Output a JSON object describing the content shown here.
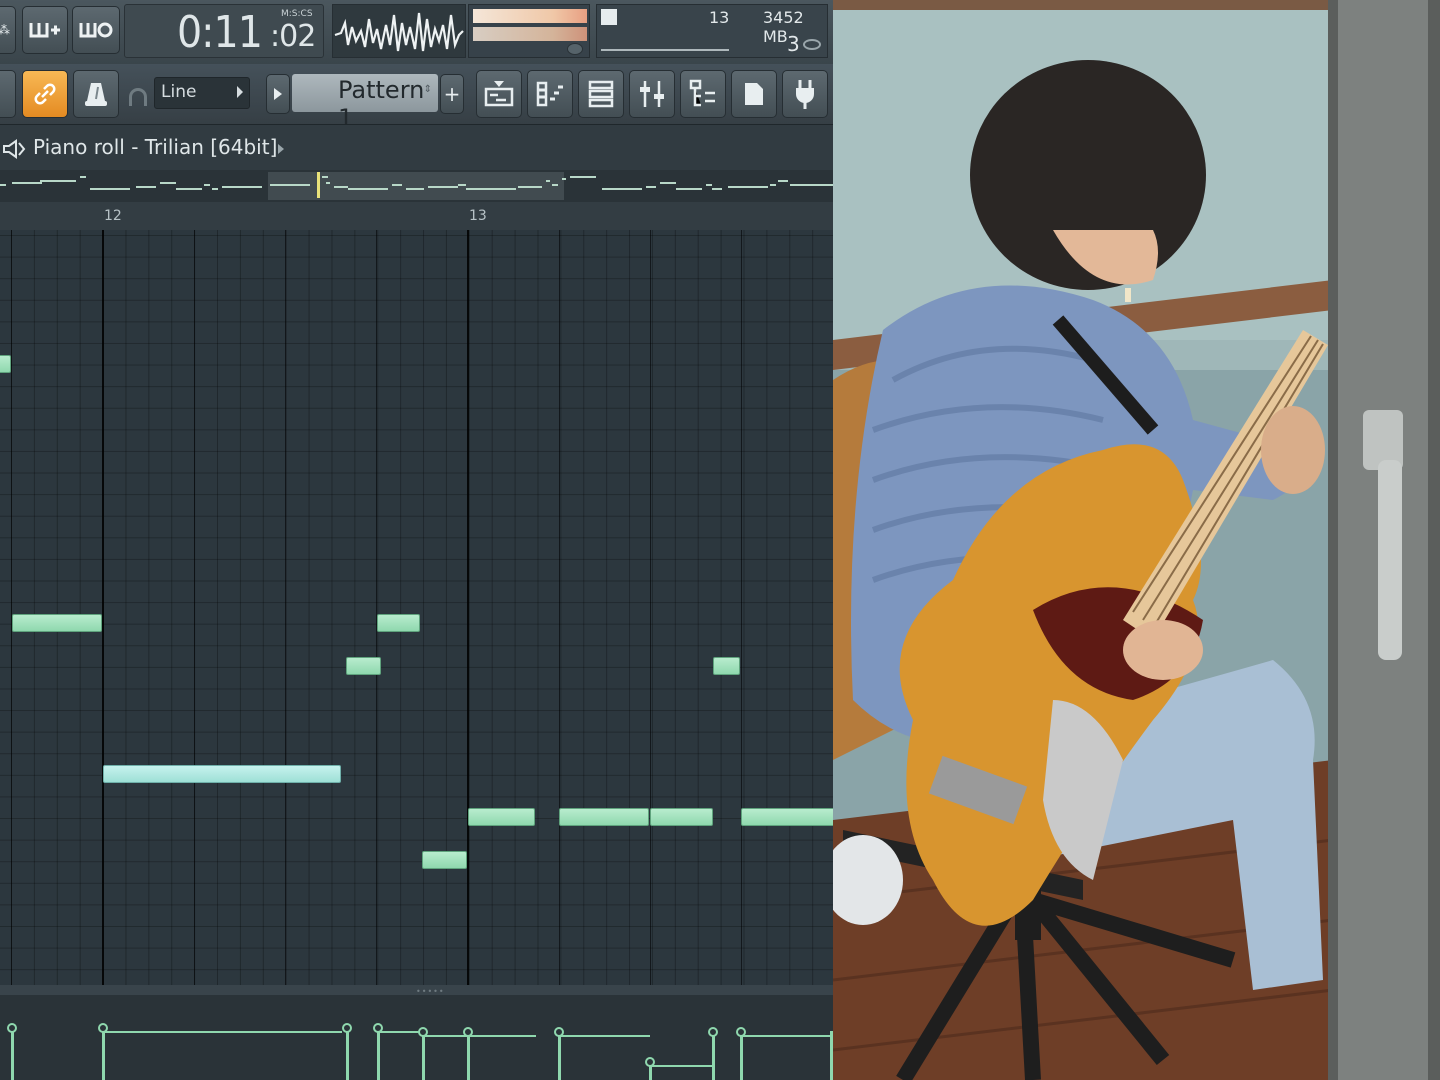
{
  "transport": {
    "time_main": "0:11",
    "time_cs": ":02",
    "time_format": "M:S:CS",
    "pattern_number": "13",
    "memory": "3452 MB",
    "cpu_count": "3"
  },
  "toolbar": {
    "snap_mode": "Line",
    "pattern_label": "Pattern 1"
  },
  "piano_roll": {
    "title": "Piano roll - Trilian [64bit]",
    "bar_labels": [
      "12",
      "13"
    ],
    "note_count": 14
  },
  "colors": {
    "note_green": "#a3e3bd",
    "note_cyan": "#b1e9e2",
    "grid_bg": "#2c373e",
    "link_button": "#f1a23a"
  },
  "icons": [
    "link-icon",
    "metronome-icon",
    "playlist-icon",
    "piano-roll-icon",
    "channel-rack-icon",
    "mixer-icon",
    "browser-icon",
    "plugin-icon"
  ]
}
